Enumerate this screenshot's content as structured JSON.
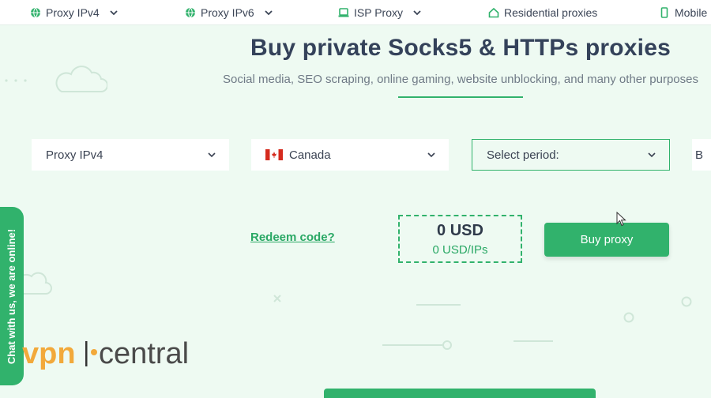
{
  "nav": {
    "items": [
      {
        "label": "Proxy IPv4",
        "icon": "globe-icon"
      },
      {
        "label": "Proxy IPv6",
        "icon": "globe-icon"
      },
      {
        "label": "ISP Proxy",
        "icon": "laptop-icon"
      },
      {
        "label": "Residential proxies",
        "icon": "home-icon"
      },
      {
        "label": "Mobile P",
        "icon": "mobile-icon"
      }
    ]
  },
  "hero": {
    "title": "Buy private Socks5 & HTTPs proxies",
    "subtitle": "Social media, SEO scraping, online gaming, website unblocking, and many other purposes"
  },
  "form": {
    "proxy_type": "Proxy IPv4",
    "country": "Canada",
    "period_placeholder": "Select period:",
    "fourth_select_partial": "B"
  },
  "redeem_label": "Redeem code?",
  "price": {
    "total": "0 USD",
    "per_ip": "0 USD/IPs"
  },
  "buy_label": "Buy proxy",
  "chat_label": "Chat with us, we are online!",
  "logo": {
    "text": "vpncentral"
  },
  "colors": {
    "accent": "#31b26c",
    "background": "#eefaf2",
    "title": "#34425a"
  }
}
